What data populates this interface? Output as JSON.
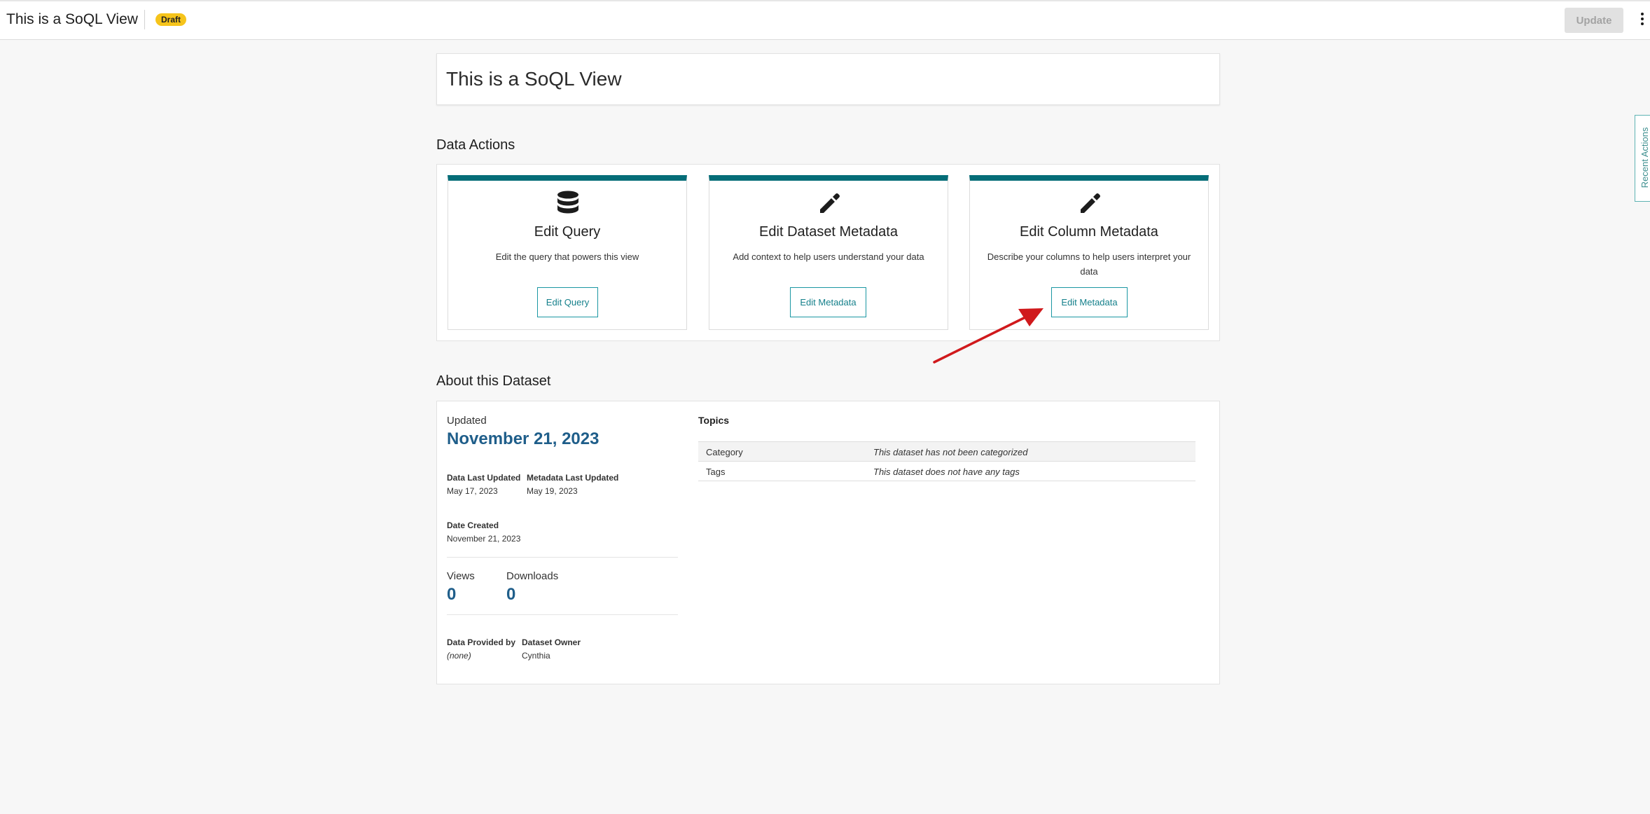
{
  "topbar": {
    "title": "This is a SoQL View",
    "badge": "Draft",
    "update_label": "Update",
    "menu_icon": "kebab-menu-icon"
  },
  "recent_actions": {
    "label": "Recent Actions"
  },
  "page_title": "This is a SoQL View",
  "data_actions": {
    "heading": "Data Actions",
    "cards": [
      {
        "icon": "database-icon",
        "title": "Edit Query",
        "description": "Edit the query that powers this view",
        "button": "Edit Query"
      },
      {
        "icon": "pencil-icon",
        "title": "Edit Dataset Metadata",
        "description": "Add context to help users understand your data",
        "button": "Edit Metadata"
      },
      {
        "icon": "pencil-icon",
        "title": "Edit Column Metadata",
        "description": "Describe your columns to help users interpret your data",
        "button": "Edit Metadata"
      }
    ]
  },
  "about": {
    "heading": "About this Dataset",
    "updated_label": "Updated",
    "updated_date": "November 21, 2023",
    "data_last_updated_label": "Data Last Updated",
    "data_last_updated": "May 17, 2023",
    "metadata_last_updated_label": "Metadata Last Updated",
    "metadata_last_updated": "May 19, 2023",
    "date_created_label": "Date Created",
    "date_created": "November 21, 2023",
    "views_label": "Views",
    "views": "0",
    "downloads_label": "Downloads",
    "downloads": "0",
    "provided_by_label": "Data Provided by",
    "provided_by": "(none)",
    "owner_label": "Dataset Owner",
    "owner": "Cynthia",
    "topics": {
      "title": "Topics",
      "rows": [
        {
          "key": "Category",
          "value": "This dataset has not been categorized"
        },
        {
          "key": "Tags",
          "value": "This dataset does not have any tags"
        }
      ]
    }
  },
  "colors": {
    "accent": "#046d78",
    "link_blue": "#1f5e8a",
    "badge": "#f6c41b",
    "annotation_arrow": "#d0191c"
  }
}
